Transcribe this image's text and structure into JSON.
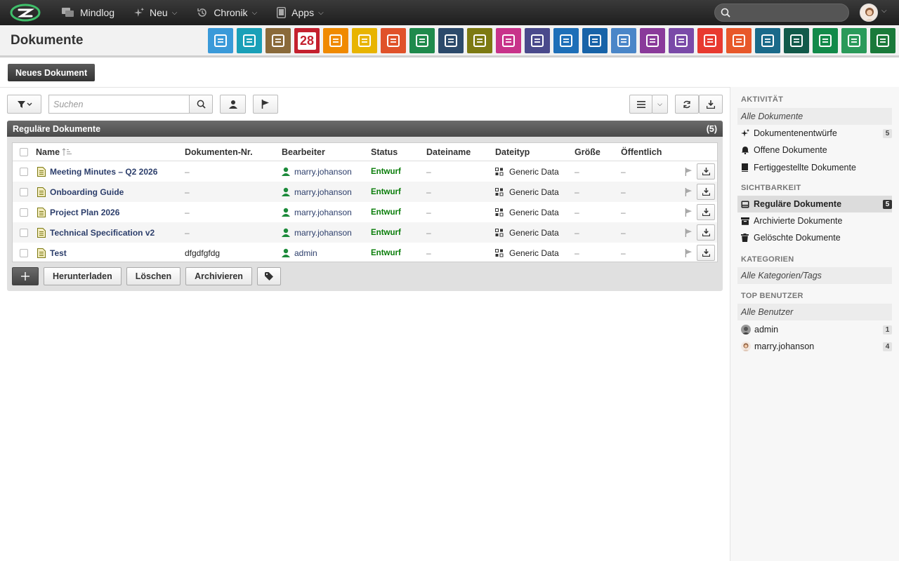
{
  "topbar": {
    "menu": [
      {
        "label": "Mindlog",
        "icon": "chat-icon",
        "dropdown": false
      },
      {
        "label": "Neu",
        "icon": "sparkle-icon",
        "dropdown": true
      },
      {
        "label": "Chronik",
        "icon": "history-icon",
        "dropdown": true
      },
      {
        "label": "Apps",
        "icon": "tablet-icon",
        "dropdown": true
      }
    ],
    "search_placeholder": ""
  },
  "header": {
    "title": "Dokumente"
  },
  "app_icons": [
    {
      "name": "mail-app-icon",
      "color": "#3a9ad9"
    },
    {
      "name": "email-address-app-icon",
      "color": "#1aa0b8"
    },
    {
      "name": "contacts-app-icon",
      "color": "#8a6a3a"
    },
    {
      "name": "calendar-app-icon",
      "color": "#c4202e",
      "text": "28"
    },
    {
      "name": "timer-app-icon",
      "color": "#f08a00"
    },
    {
      "name": "tasks-app-icon",
      "color": "#e8b400"
    },
    {
      "name": "projects-app-icon",
      "color": "#e0522a"
    },
    {
      "name": "notes-app-icon",
      "color": "#1f8a4c"
    },
    {
      "name": "bookmarks-app-icon",
      "color": "#2c4a6b"
    },
    {
      "name": "documents-app-icon",
      "color": "#7d7a12"
    },
    {
      "name": "reception-app-icon",
      "color": "#c8338a"
    },
    {
      "name": "finance-app-icon",
      "color": "#4a4a8c"
    },
    {
      "name": "delivery-app-icon",
      "color": "#1e6fb8"
    },
    {
      "name": "support-app-icon",
      "color": "#1763a8"
    },
    {
      "name": "money-bag-app-icon",
      "color": "#4a86c8"
    },
    {
      "name": "contracts-app-icon",
      "color": "#8a3a9a"
    },
    {
      "name": "deals-app-icon",
      "color": "#7a4aa8"
    },
    {
      "name": "pdf-app-icon",
      "color": "#e83a30"
    },
    {
      "name": "broadcast-app-icon",
      "color": "#e8582a"
    },
    {
      "name": "downloads-app-icon",
      "color": "#1a6a8a"
    },
    {
      "name": "shop-app-icon",
      "color": "#125a4a"
    },
    {
      "name": "billing-app-icon",
      "color": "#128a4a"
    },
    {
      "name": "price-tag-app-icon",
      "color": "#2a9a5a"
    },
    {
      "name": "database-app-icon",
      "color": "#1a7a3a"
    }
  ],
  "new_button": "Neues Dokument",
  "toolbar": {
    "search_placeholder": "Suchen"
  },
  "panel": {
    "title": "Reguläre Dokumente",
    "count": "(5)"
  },
  "table": {
    "columns": [
      "Name",
      "Dokumenten-Nr.",
      "Bearbeiter",
      "Status",
      "Dateiname",
      "Dateityp",
      "Größe",
      "Öffentlich"
    ],
    "rows": [
      {
        "name": "Meeting Minutes – Q2 2026",
        "doc_nr": "–",
        "editor": "marry.johanson",
        "status": "Entwurf",
        "filename": "–",
        "filetype": "Generic Data",
        "size": "–",
        "public": "–"
      },
      {
        "name": "Onboarding Guide",
        "doc_nr": "–",
        "editor": "marry.johanson",
        "status": "Entwurf",
        "filename": "–",
        "filetype": "Generic Data",
        "size": "–",
        "public": "–"
      },
      {
        "name": "Project Plan 2026",
        "doc_nr": "–",
        "editor": "marry.johanson",
        "status": "Entwurf",
        "filename": "–",
        "filetype": "Generic Data",
        "size": "–",
        "public": "–"
      },
      {
        "name": "Technical Specification v2",
        "doc_nr": "–",
        "editor": "marry.johanson",
        "status": "Entwurf",
        "filename": "–",
        "filetype": "Generic Data",
        "size": "–",
        "public": "–"
      },
      {
        "name": "Test",
        "doc_nr": "dfgdfgfdg",
        "editor": "admin",
        "status": "Entwurf",
        "filename": "–",
        "filetype": "Generic Data",
        "size": "–",
        "public": "–"
      }
    ]
  },
  "actions": {
    "add": "+",
    "download": "Herunterladen",
    "delete": "Löschen",
    "archive": "Archivieren"
  },
  "sidebar": {
    "activity_title": "AKTIVITÄT",
    "all_docs": "Alle Dokumente",
    "drafts": "Dokumentenentwürfe",
    "drafts_count": "5",
    "open": "Offene Dokumente",
    "finished": "Fertiggestellte Dokumente",
    "visibility_title": "SICHTBARKEIT",
    "regular": "Reguläre Dokumente",
    "regular_count": "5",
    "archived": "Archivierte Dokumente",
    "deleted": "Gelöschte Dokumente",
    "categories_title": "KATEGORIEN",
    "all_categories": "Alle Kategorien/Tags",
    "top_users_title": "TOP BENUTZER",
    "all_users": "Alle Benutzer",
    "users": [
      {
        "name": "admin",
        "count": "1"
      },
      {
        "name": "marry.johanson",
        "count": "4"
      }
    ]
  }
}
